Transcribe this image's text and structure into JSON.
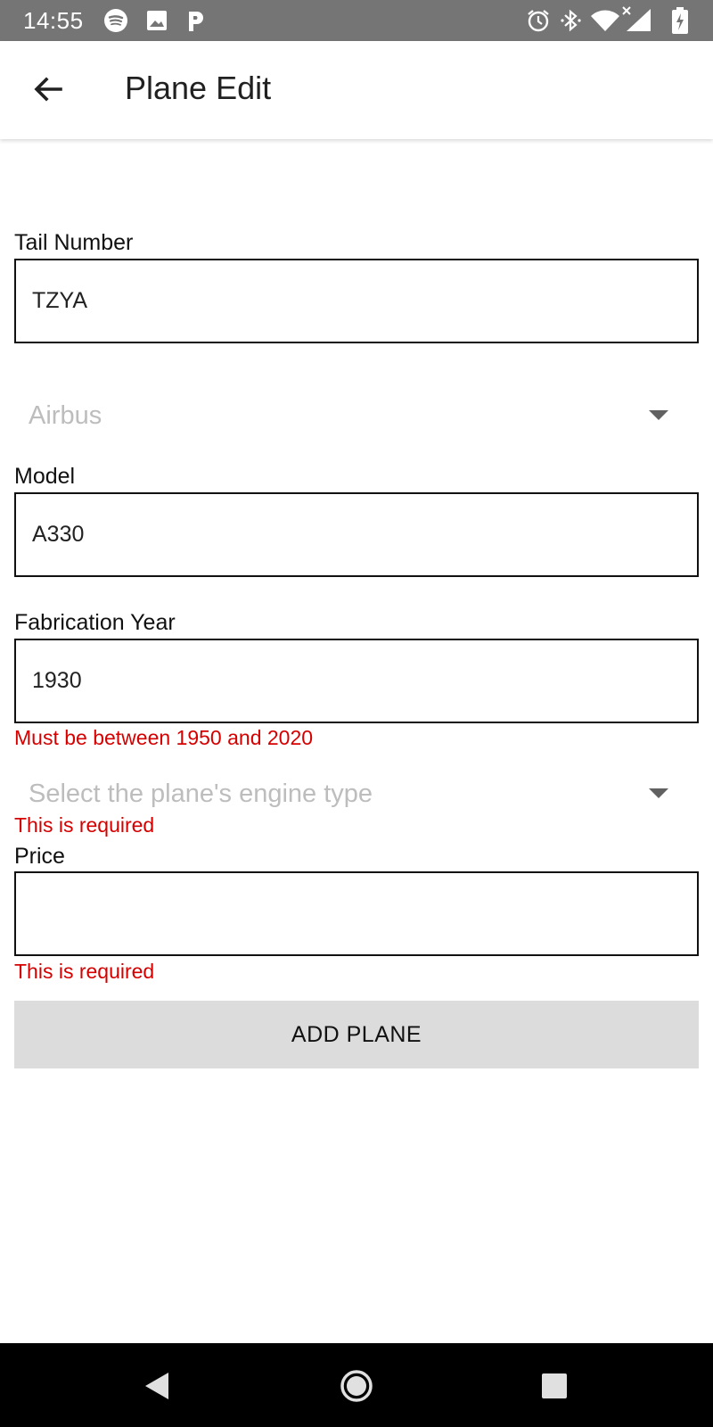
{
  "status_bar": {
    "time": "14:55",
    "icons": [
      "spotify-icon",
      "image-icon",
      "parking-icon",
      "alarm-icon",
      "bluetooth-icon",
      "wifi-icon",
      "cellular-signal-icon",
      "battery-charging-icon"
    ]
  },
  "app_bar": {
    "title": "Plane Edit",
    "back_icon": "arrow-back-icon"
  },
  "form": {
    "tail_number": {
      "label": "Tail Number",
      "value": "TZYA"
    },
    "manufacturer": {
      "value": "Airbus"
    },
    "model": {
      "label": "Model",
      "value": "A330"
    },
    "fabrication_year": {
      "label": "Fabrication Year",
      "value": "1930",
      "error": "Must be between 1950 and 2020"
    },
    "engine_type": {
      "placeholder": "Select the plane's engine type",
      "error": "This is required"
    },
    "price": {
      "label": "Price",
      "value": "",
      "error": "This is required"
    },
    "submit_label": "ADD PLANE"
  },
  "colors": {
    "status_bar": "#757575",
    "error": "#d50000",
    "button_bg": "#dcdcdc",
    "placeholder": "#bdbdbd"
  },
  "nav_bar": {
    "icons": [
      "nav-back-icon",
      "nav-home-icon",
      "nav-recents-icon"
    ]
  }
}
